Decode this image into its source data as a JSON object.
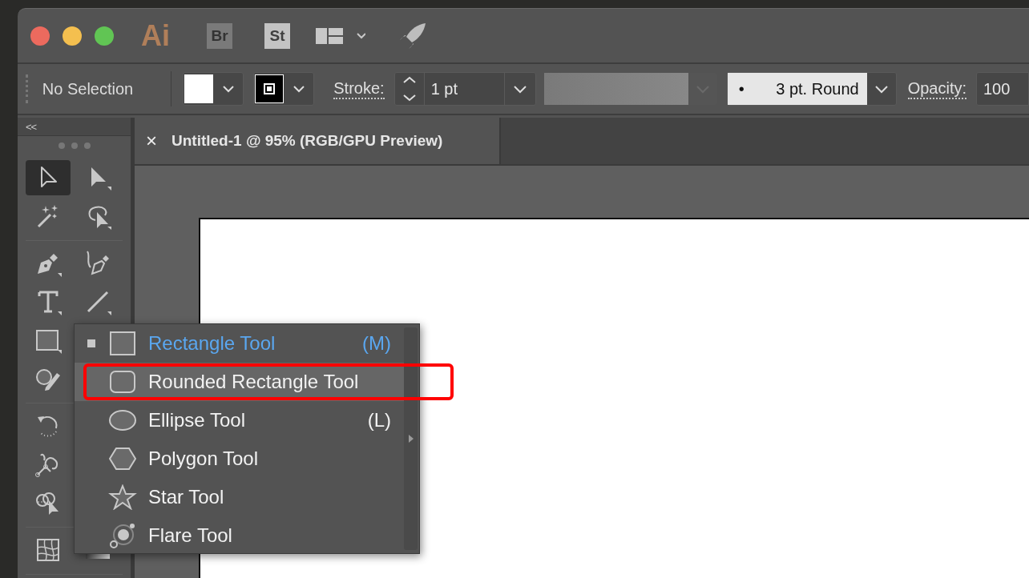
{
  "app_bar": {
    "logo": "Ai",
    "apps": [
      {
        "label": "Br",
        "kind": "bridge"
      },
      {
        "label": "St",
        "kind": "stock"
      }
    ]
  },
  "control_bar": {
    "selection": "No Selection",
    "stroke_label": "Stroke:",
    "stroke_weight": "1 pt",
    "brush": {
      "bullet": "•",
      "label": "3 pt. Round"
    },
    "opacity_label": "Opacity:",
    "opacity_value": "100"
  },
  "toolbar": {
    "collapse": "<<",
    "groups": [
      [
        [
          {
            "kind": "selection",
            "selected": true
          },
          {
            "kind": "direct-selection",
            "selected": false
          }
        ],
        [
          {
            "kind": "magic-wand",
            "selected": false
          },
          {
            "kind": "lasso",
            "selected": false
          }
        ]
      ],
      [
        [
          {
            "kind": "pen",
            "selected": false
          },
          {
            "kind": "curvature",
            "selected": false
          }
        ],
        [
          {
            "kind": "type",
            "selected": false
          },
          {
            "kind": "line",
            "selected": false
          }
        ],
        [
          {
            "kind": "rectangle",
            "selected": false
          }
        ],
        [
          {
            "kind": "shaper",
            "selected": false
          }
        ]
      ],
      [
        [
          {
            "kind": "rotate",
            "selected": false
          }
        ],
        [
          {
            "kind": "puppet-warp",
            "selected": false
          }
        ],
        [
          {
            "kind": "shape-builder",
            "selected": false
          }
        ]
      ],
      [
        [
          {
            "kind": "mesh",
            "selected": false
          },
          {
            "kind": "gradient",
            "selected": false
          }
        ]
      ]
    ]
  },
  "document_tab": {
    "close": "×",
    "title": "Untitled-1 @ 95% (RGB/GPU Preview)"
  },
  "flyout": {
    "items": [
      {
        "kind": "rectangle",
        "label": "Rectangle Tool",
        "shortcut": "(M)",
        "selected": true,
        "hovered": false,
        "annotated": false
      },
      {
        "kind": "rounded-rectangle",
        "label": "Rounded Rectangle Tool",
        "selected": false,
        "hovered": true,
        "annotated": true
      },
      {
        "kind": "ellipse",
        "label": "Ellipse Tool",
        "shortcut": "(L)",
        "selected": false,
        "hovered": false,
        "annotated": false
      },
      {
        "kind": "polygon",
        "label": "Polygon Tool",
        "selected": false,
        "hovered": false,
        "annotated": false
      },
      {
        "kind": "star",
        "label": "Star Tool",
        "selected": false,
        "hovered": false,
        "annotated": false
      },
      {
        "kind": "flare",
        "label": "Flare Tool",
        "selected": false,
        "hovered": false,
        "annotated": false
      }
    ]
  }
}
